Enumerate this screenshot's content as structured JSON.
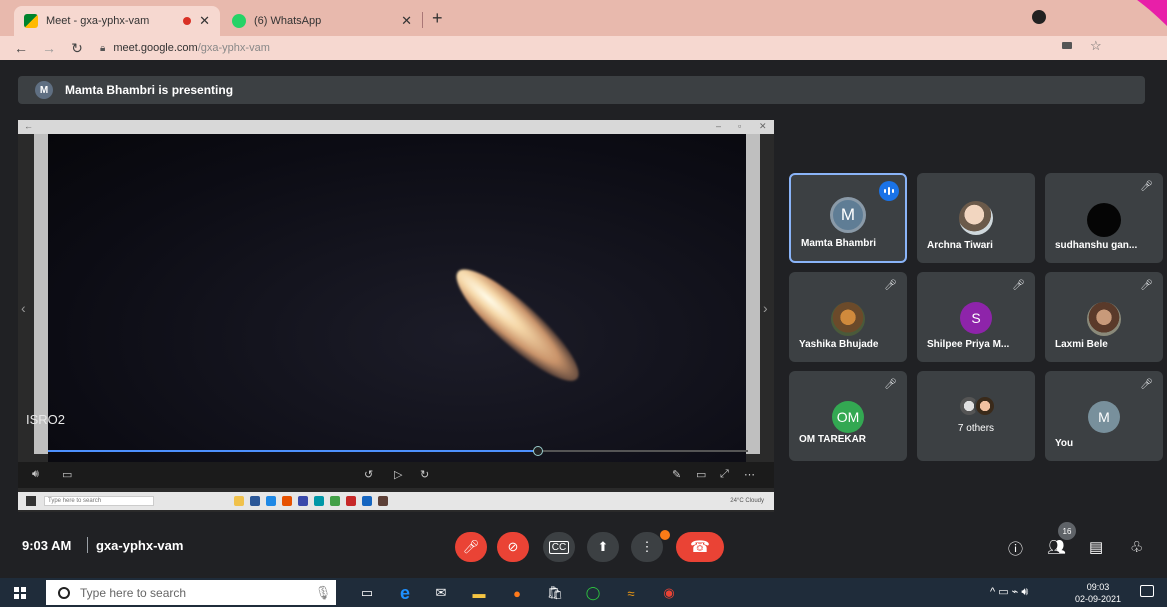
{
  "browser": {
    "tabs": [
      {
        "title": "Meet - gxa-yphx-vam",
        "active": true
      },
      {
        "title": "(6) WhatsApp",
        "active": false
      }
    ],
    "url_host": "meet.google.com",
    "url_path": "/gxa-yphx-vam"
  },
  "banner": {
    "avatar_letter": "M",
    "text": "Mamta Bhambri is presenting"
  },
  "presentation": {
    "label": "ISRO2",
    "progress": 0.7,
    "inner_search_placeholder": "Type here to search",
    "inner_tray": "24°C Cloudy"
  },
  "participants": [
    {
      "name": "Mamta Bhambri",
      "avatar_letter": "M",
      "avatar_color": "#5f7d95",
      "speaking": true,
      "muted": false
    },
    {
      "name": "Archna Tiwari",
      "photo": true,
      "muted": false
    },
    {
      "name": "sudhanshu gan...",
      "photo_dark": true,
      "muted": true
    },
    {
      "name": "Yashika Bhujade",
      "photo": true,
      "muted": true
    },
    {
      "name": "Shilpee Priya M...",
      "avatar_letter": "S",
      "avatar_color": "#8e24aa",
      "muted": true
    },
    {
      "name": "Laxmi Bele",
      "photo": true,
      "muted": true
    },
    {
      "name": "OM TAREKAR",
      "avatar_letter": "OM",
      "avatar_color": "#33a852",
      "muted": true
    },
    {
      "name": "",
      "others_label": "7 others",
      "muted": false
    },
    {
      "name": "You",
      "avatar_letter": "M",
      "avatar_color": "#78909c",
      "muted": true
    }
  ],
  "meetbar": {
    "time": "9:03 AM",
    "meeting_code": "gxa-yphx-vam",
    "people_count": "16"
  },
  "taskbar": {
    "search_placeholder": "Type here to search",
    "clock_time": "09:03",
    "clock_date": "02-09-2021"
  },
  "colors": {
    "meet_bg": "#202124",
    "tile_bg": "#3c4043",
    "red": "#ea4335",
    "accent_blue": "#8ab4f8"
  }
}
